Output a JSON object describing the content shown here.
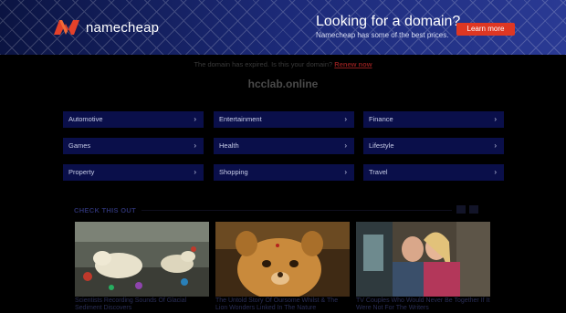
{
  "banner": {
    "logo_text": "namecheap",
    "promo_title": "Looking for a domain?",
    "promo_subtitle": "Namecheap has some of the best prices.",
    "cta_label": "Learn more",
    "accent_color": "#de3723"
  },
  "notice": {
    "text": "The domain has expired. Is this your domain?",
    "renew_label": "Renew now"
  },
  "domain_name": "hcclab.online",
  "categories": [
    {
      "label": "Automotive"
    },
    {
      "label": "Entertainment"
    },
    {
      "label": "Finance"
    },
    {
      "label": "Games"
    },
    {
      "label": "Health"
    },
    {
      "label": "Lifestyle"
    },
    {
      "label": "Property"
    },
    {
      "label": "Shopping"
    },
    {
      "label": "Travel"
    }
  ],
  "check_this_out": {
    "title": "CHECK THIS OUT",
    "cards": [
      {
        "caption": "Scientists Recording Sounds Of Glacial Sediment Discovers",
        "image": "polar-bear-landfill"
      },
      {
        "caption": "The Untold Story Of Oursome Whilst & The Lion Wonders Linked In The Nature",
        "image": "lion-cub"
      },
      {
        "caption": "TV Couples Who Would Never Be Together If It Were Not For The Writers",
        "image": "tv-couple-kiss"
      }
    ]
  }
}
